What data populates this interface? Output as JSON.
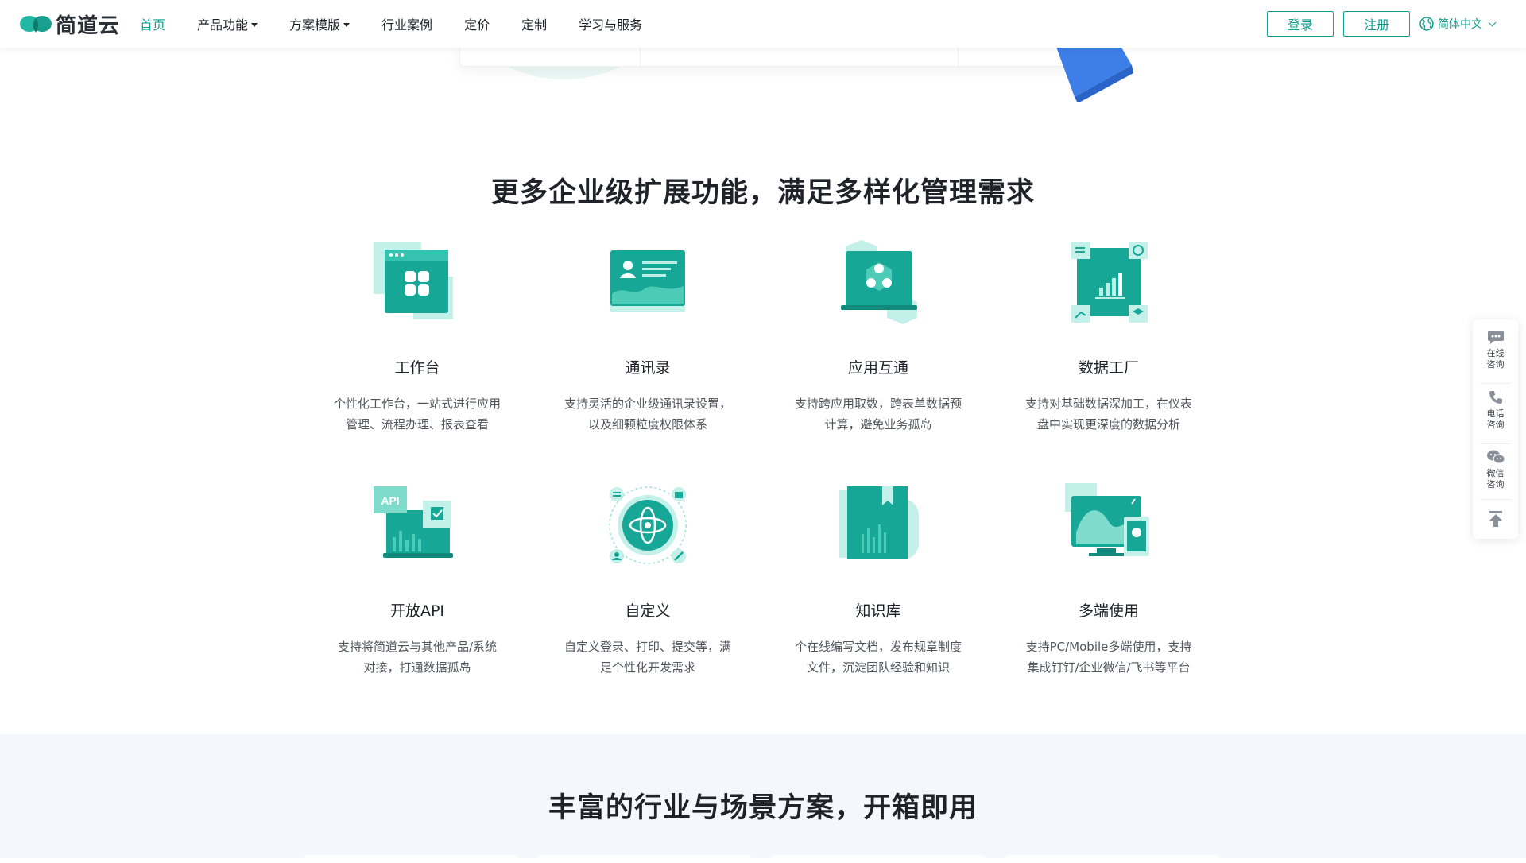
{
  "header": {
    "logo_text": "简道云",
    "nav": [
      {
        "label": "首页",
        "active": true,
        "dropdown": false
      },
      {
        "label": "产品功能",
        "active": false,
        "dropdown": true
      },
      {
        "label": "方案模版",
        "active": false,
        "dropdown": true
      },
      {
        "label": "行业案例",
        "active": false,
        "dropdown": false
      },
      {
        "label": "定价",
        "active": false,
        "dropdown": false
      },
      {
        "label": "定制",
        "active": false,
        "dropdown": false
      },
      {
        "label": "学习与服务",
        "active": false,
        "dropdown": false
      }
    ],
    "login_label": "登录",
    "register_label": "注册",
    "language_label": "简体中文"
  },
  "features_section": {
    "title": "更多企业级扩展功能，满足多样化管理需求",
    "items": [
      {
        "icon": "workbench-icon",
        "name": "工作台",
        "desc_line1": "个性化工作台，一站式进行应用",
        "desc_line2": "管理、流程办理、报表查看"
      },
      {
        "icon": "contacts-icon",
        "name": "通讯录",
        "desc_line1": "支持灵活的企业级通讯录设置，",
        "desc_line2": "以及细颗粒度权限体系"
      },
      {
        "icon": "app-interop-icon",
        "name": "应用互通",
        "desc_line1": "支持跨应用取数，跨表单数据预",
        "desc_line2": "计算，避免业务孤岛"
      },
      {
        "icon": "data-factory-icon",
        "name": "数据工厂",
        "desc_line1": "支持对基础数据深加工，在仪表",
        "desc_line2": "盘中实现更深度的数据分析"
      },
      {
        "icon": "open-api-icon",
        "name": "开放API",
        "desc_line1": "支持将简道云与其他产品/系统",
        "desc_line2": "对接，打通数据孤岛"
      },
      {
        "icon": "customize-icon",
        "name": "自定义",
        "desc_line1": "自定义登录、打印、提交等，满",
        "desc_line2": "足个性化开发需求"
      },
      {
        "icon": "knowledge-base-icon",
        "name": "知识库",
        "desc_line1": "个在线编写文档，发布规章制度",
        "desc_line2": "文件，沉淀团队经验和知识"
      },
      {
        "icon": "multi-device-icon",
        "name": "多端使用",
        "desc_line1": "支持PC/Mobile多端使用，支持",
        "desc_line2": "集成钉钉/企业微信/飞书等平台"
      }
    ]
  },
  "solutions_section": {
    "title": "丰富的行业与场景方案，开箱即用"
  },
  "float_bar": {
    "online": {
      "line1": "在线",
      "line2": "咨询"
    },
    "phone": {
      "line1": "电话",
      "line2": "咨询"
    },
    "wechat": {
      "line1": "微信",
      "line2": "咨询"
    }
  },
  "colors": {
    "brand": "#0e9f8f",
    "icon_dark": "#13a593",
    "icon_light": "#b7ede6",
    "band_bg": "#f4f8fd"
  }
}
